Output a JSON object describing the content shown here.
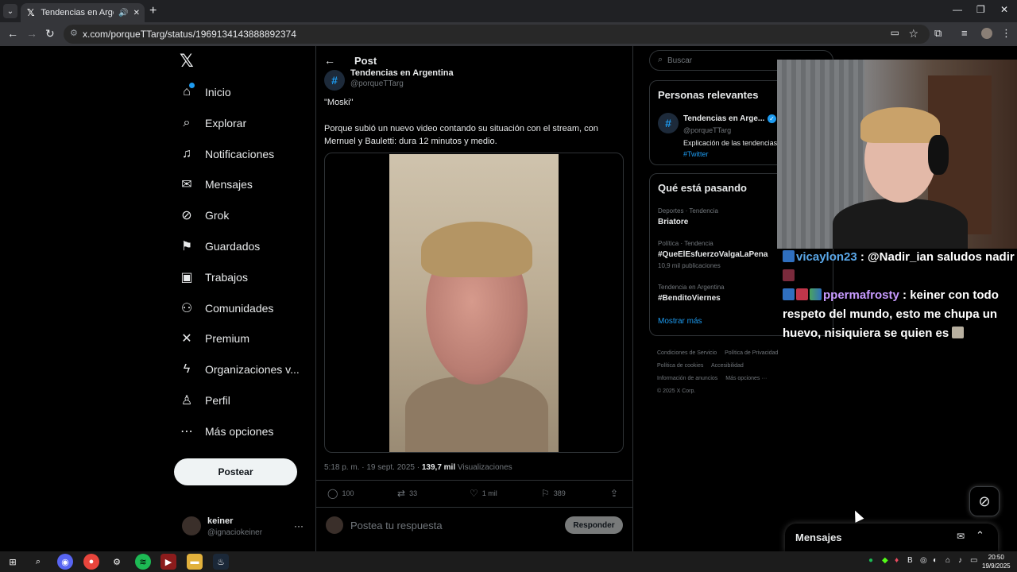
{
  "browser": {
    "tab_title": "Tendencias en Argentina en...",
    "tab_audio_icon": "speaker-icon",
    "url": "x.com/porqueTTarg/status/1969134143888892374"
  },
  "nav": {
    "items": [
      {
        "label": "Inicio",
        "icon": "home-icon"
      },
      {
        "label": "Explorar",
        "icon": "search-icon"
      },
      {
        "label": "Notificaciones",
        "icon": "bell-icon"
      },
      {
        "label": "Mensajes",
        "icon": "mail-icon"
      },
      {
        "label": "Grok",
        "icon": "grok-icon"
      },
      {
        "label": "Guardados",
        "icon": "bookmark-icon"
      },
      {
        "label": "Trabajos",
        "icon": "briefcase-icon"
      },
      {
        "label": "Comunidades",
        "icon": "people-icon"
      },
      {
        "label": "Premium",
        "icon": "x-icon"
      },
      {
        "label": "Organizaciones v...",
        "icon": "lightning-icon"
      },
      {
        "label": "Perfil",
        "icon": "person-icon"
      },
      {
        "label": "Más opciones",
        "icon": "more-circle-icon"
      }
    ],
    "post_button": "Postear",
    "account": {
      "name": "keiner",
      "handle": "@ignaciokeiner"
    }
  },
  "post": {
    "header": "Post",
    "author_name": "Tendencias en Argentina",
    "author_handle": "@porqueTTarg",
    "text1": "\"Moski\"",
    "text2": "Porque subió un nuevo video contando su situación con el stream, con Mernuel y Bauletti: dura 12 minutos y medio.",
    "time": "5:18 p. m. · 19 sept. 2025 · ",
    "views_count": "139,7 mil",
    "views_label": " Visualizaciones",
    "replies": "100",
    "reposts": "33",
    "likes": "1 mil",
    "bookmarks": "389",
    "reply_placeholder": "Postea tu respuesta",
    "reply_button": "Responder"
  },
  "sidebar": {
    "search_placeholder": "Buscar",
    "relevant_title": "Personas relevantes",
    "relevant": {
      "name": "Tendencias en Arge...",
      "handle": "@porqueTTarg",
      "bio": "Explicación de las tendencias",
      "tag": "#Twitter"
    },
    "trends_title": "Qué está pasando",
    "trends": [
      {
        "category": "Deportes · Tendencia",
        "name": "Briatore",
        "count": ""
      },
      {
        "category": "Política · Tendencia",
        "name": "#QueElEsfuerzoValgaLaPena",
        "count": "10,9 mil publicaciones"
      },
      {
        "category": "Tendencia en Argentina",
        "name": "#BenditoViernes",
        "count": ""
      }
    ],
    "show_more": "Mostrar más",
    "footer": [
      "Condiciones de Servicio",
      "Política de Privacidad",
      "Política de cookies",
      "Accesibilidad",
      "Información de anuncios",
      "Más opciones ···",
      "© 2025 X Corp."
    ]
  },
  "chat": {
    "messages": [
      {
        "user": "vicaylon23",
        "text": " : @Nadir_ian saludos nadir"
      },
      {
        "user": "ppermafrosty",
        "text": " : keiner con todo respeto del mundo, esto me chupa un huevo, nisiquiera se quien es "
      }
    ]
  },
  "messages_drawer": {
    "title": "Mensajes"
  },
  "taskbar": {
    "time": "20:50",
    "date": "19/9/2025"
  }
}
